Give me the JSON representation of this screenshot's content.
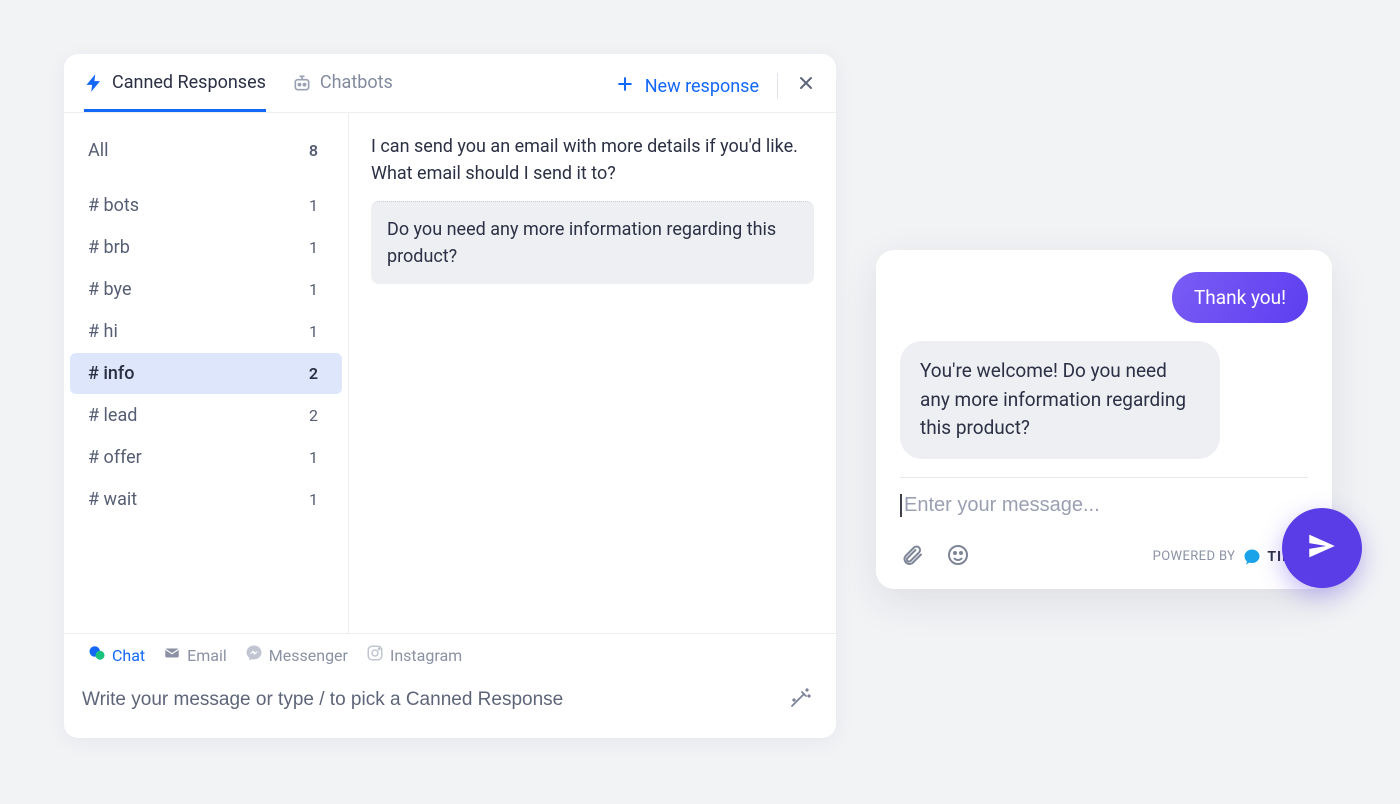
{
  "panel": {
    "tabs": {
      "canned": "Canned Responses",
      "chatbots": "Chatbots"
    },
    "new_response": "New response",
    "sidebar": {
      "all_label": "All",
      "all_count": "8",
      "tags": [
        {
          "label": "# bots",
          "count": "1"
        },
        {
          "label": "# brb",
          "count": "1"
        },
        {
          "label": "# bye",
          "count": "1"
        },
        {
          "label": "# hi",
          "count": "1"
        },
        {
          "label": "# info",
          "count": "2"
        },
        {
          "label": "# lead",
          "count": "2"
        },
        {
          "label": "# offer",
          "count": "1"
        },
        {
          "label": "# wait",
          "count": "1"
        }
      ]
    },
    "preview": {
      "line1": "I can send you an email with more details if you'd like. What email should I send it to?",
      "line2": "Do you need any more information regarding this product?"
    },
    "channels": {
      "chat": "Chat",
      "email": "Email",
      "messenger": "Messenger",
      "instagram": "Instagram"
    },
    "compose_placeholder": "Write your message or type / to pick a Canned Response"
  },
  "chat": {
    "sent": "Thank you!",
    "received": "You're welcome! Do you need any more information regarding this product?",
    "input_placeholder": "Enter your message...",
    "powered_by": "POWERED BY",
    "brand": "TIDIO"
  }
}
